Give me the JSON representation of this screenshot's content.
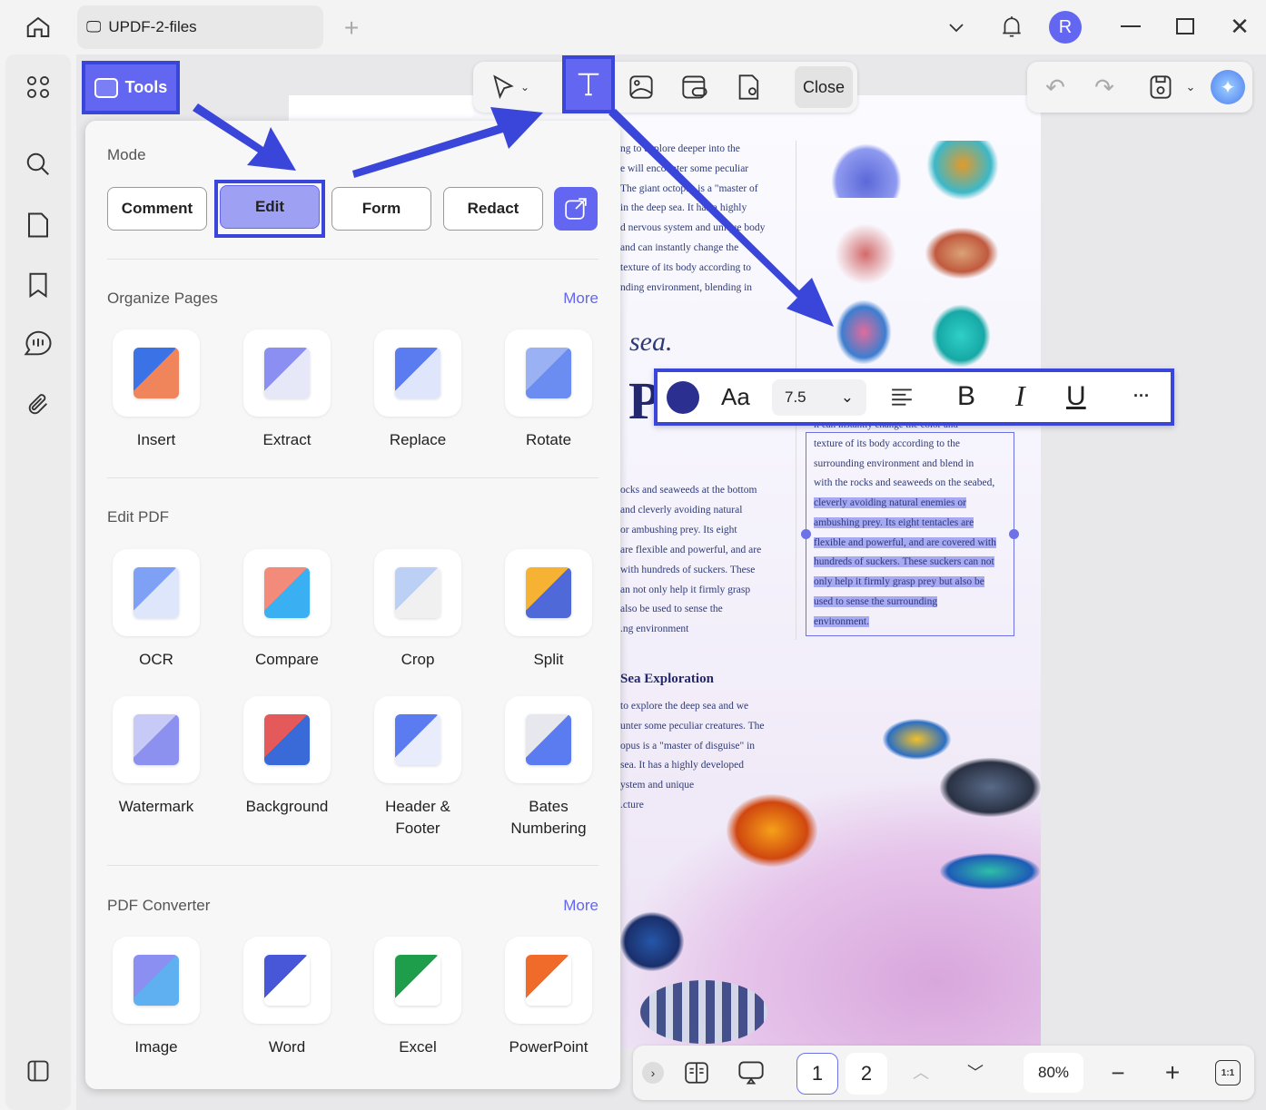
{
  "window": {
    "tab_title": "UPDF-2-files",
    "avatar_letter": "R"
  },
  "tools_button": "Tools",
  "edit_toolbar": {
    "close": "Close"
  },
  "panel": {
    "mode_label": "Mode",
    "modes": [
      "Comment",
      "Edit",
      "Form",
      "Redact"
    ],
    "organize": {
      "title": "Organize Pages",
      "more": "More",
      "items": [
        "Insert",
        "Extract",
        "Replace",
        "Rotate"
      ]
    },
    "edit": {
      "title": "Edit PDF",
      "items": [
        "OCR",
        "Compare",
        "Crop",
        "Split",
        "Watermark",
        "Background",
        "Header &\nFooter",
        "Bates\nNumbering"
      ]
    },
    "converter": {
      "title": "PDF Converter",
      "more": "More",
      "items": [
        "Image",
        "Word",
        "Excel",
        "PowerPoint"
      ]
    }
  },
  "format_toolbar": {
    "font_label": "Aa",
    "size": "7.5",
    "bold": "B",
    "italic": "I",
    "underline": "U",
    "more": "···",
    "color": "#2b2f8f"
  },
  "document": {
    "col1_top": [
      "ng to explore deeper into the",
      "e will encounter some peculiar",
      "The giant octopus is a \"master of",
      "in the deep sea. It has a highly",
      "d nervous system and unique body",
      "and can instantly change the",
      "texture of its body according to",
      "nding environment, blending in"
    ],
    "sea_heading": "sea.",
    "big_letter": "P",
    "col1_mid": [
      "ocks and seaweeds at the bottom",
      "and cleverly avoiding natural",
      "or ambushing prey. Its eight",
      "are flexible and powerful, and are",
      "with hundreds of suckers. These",
      "an not only help it firmly grasp",
      "also be used to sense the",
      "ng environment."
    ],
    "textbox_clipped": "it can instantly change the color and",
    "textbox_plain": [
      "texture of its body according to the",
      "surrounding environment and blend in",
      "with the rocks and seaweeds on the seabed,"
    ],
    "textbox_selected": [
      "cleverly avoiding natural enemies or",
      "ambushing prey. Its eight tentacles are",
      "flexible and powerful, and are covered with",
      "hundreds of suckers. These suckers can not",
      "only help it firmly grasp prey but also be",
      "used to sense the surrounding",
      "environment."
    ],
    "exploration_heading": "Sea Exploration",
    "col1_bottom": [
      "to explore the deep sea and we",
      "unter some peculiar creatures. The",
      "opus is a \"master of disguise\" in",
      "sea. It has a highly developed",
      "ystem and unique",
      "cture."
    ]
  },
  "bottom_bar": {
    "pages": [
      "1",
      "2"
    ],
    "zoom": "80%",
    "fit": "1:1"
  },
  "colors": {
    "accent": "#6366f1",
    "highlight": "#3a46d9"
  }
}
